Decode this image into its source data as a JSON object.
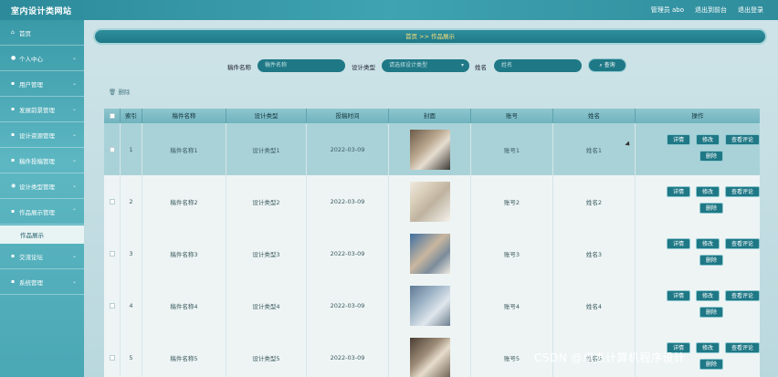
{
  "header": {
    "brand": "室内设计类网站",
    "user": "管理员 abo",
    "back_home": "退出到前台",
    "logout": "退出登录"
  },
  "sidebar": {
    "items": [
      {
        "label": "首页",
        "icon": "home-icon"
      },
      {
        "label": "个人中心",
        "icon": "user-icon"
      },
      {
        "label": "用户管理",
        "icon": "grid-icon"
      },
      {
        "label": "发展前景管理",
        "icon": "grid-icon"
      },
      {
        "label": "设计资源管理",
        "icon": "grid-icon"
      },
      {
        "label": "稿件投稿管理",
        "icon": "grid-icon"
      },
      {
        "label": "设计类型管理",
        "icon": "pin-icon"
      },
      {
        "label": "作品展示管理",
        "icon": "grid-icon"
      },
      {
        "label": "交流论坛",
        "icon": "grid-icon"
      },
      {
        "label": "系统管理",
        "icon": "grid-icon"
      }
    ],
    "active_sub": "作品展示"
  },
  "breadcrumb": {
    "home": "首页",
    "sep": ">>",
    "current": "作品展示"
  },
  "search": {
    "name_label": "稿件名称",
    "name_placeholder": "稿件名称",
    "type_label": "设计类型",
    "type_placeholder": "请选择设计类型",
    "author_label": "姓名",
    "author_placeholder": "姓名",
    "button": "查询"
  },
  "toolbar": {
    "delete": "删除"
  },
  "table": {
    "columns": [
      "索引",
      "稿件名称",
      "设计类型",
      "投稿时间",
      "封面",
      "账号",
      "姓名",
      "操作"
    ],
    "rows": [
      {
        "index": "1",
        "name": "稿件名称1",
        "type": "设计类型1",
        "date": "2022-03-09",
        "account": "账号1",
        "author": "姓名1"
      },
      {
        "index": "2",
        "name": "稿件名称2",
        "type": "设计类型2",
        "date": "2022-03-09",
        "account": "账号2",
        "author": "姓名2"
      },
      {
        "index": "3",
        "name": "稿件名称3",
        "type": "设计类型3",
        "date": "2022-03-09",
        "account": "账号3",
        "author": "姓名3"
      },
      {
        "index": "4",
        "name": "稿件名称4",
        "type": "设计类型4",
        "date": "2022-03-09",
        "account": "账号4",
        "author": "姓名4"
      },
      {
        "index": "5",
        "name": "稿件名称5",
        "type": "设计类型5",
        "date": "2022-03-09",
        "account": "账号5",
        "author": "姓名5"
      }
    ],
    "actions": {
      "detail": "详情",
      "edit": "修改",
      "comments": "查看评论",
      "delete": "删除"
    }
  },
  "watermark": "CSDN @卓杰计算机程序设计"
}
